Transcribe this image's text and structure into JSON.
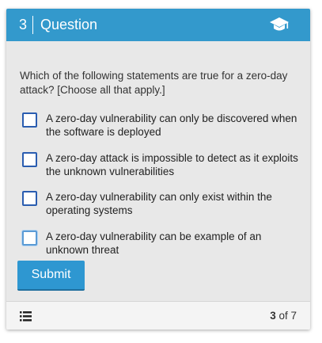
{
  "header": {
    "question_number": "3",
    "title": "Question",
    "icon": "graduation-cap-icon"
  },
  "question": {
    "prompt": "Which of the following statements are true for a zero-day attack? [Choose all that apply.]",
    "options": [
      {
        "label": "A zero-day vulnerability can only be discovered when the software is deployed",
        "checked": false
      },
      {
        "label": "A zero-day attack is impossible to detect as it exploits the unknown vulnerabilities",
        "checked": false
      },
      {
        "label": "A zero-day vulnerability can only exist within the operating systems",
        "checked": false
      },
      {
        "label": "A zero-day vulnerability can be example of an unknown threat",
        "checked": false
      }
    ]
  },
  "actions": {
    "submit_label": "Submit"
  },
  "footer": {
    "list_icon": "list-icon",
    "current": "3",
    "of_text": "of 7"
  },
  "colors": {
    "header_bg": "#3399cc",
    "submit_bg": "#2e97d1",
    "checkbox_border": "#2a5db0",
    "card_bg": "#e8e8e8"
  }
}
